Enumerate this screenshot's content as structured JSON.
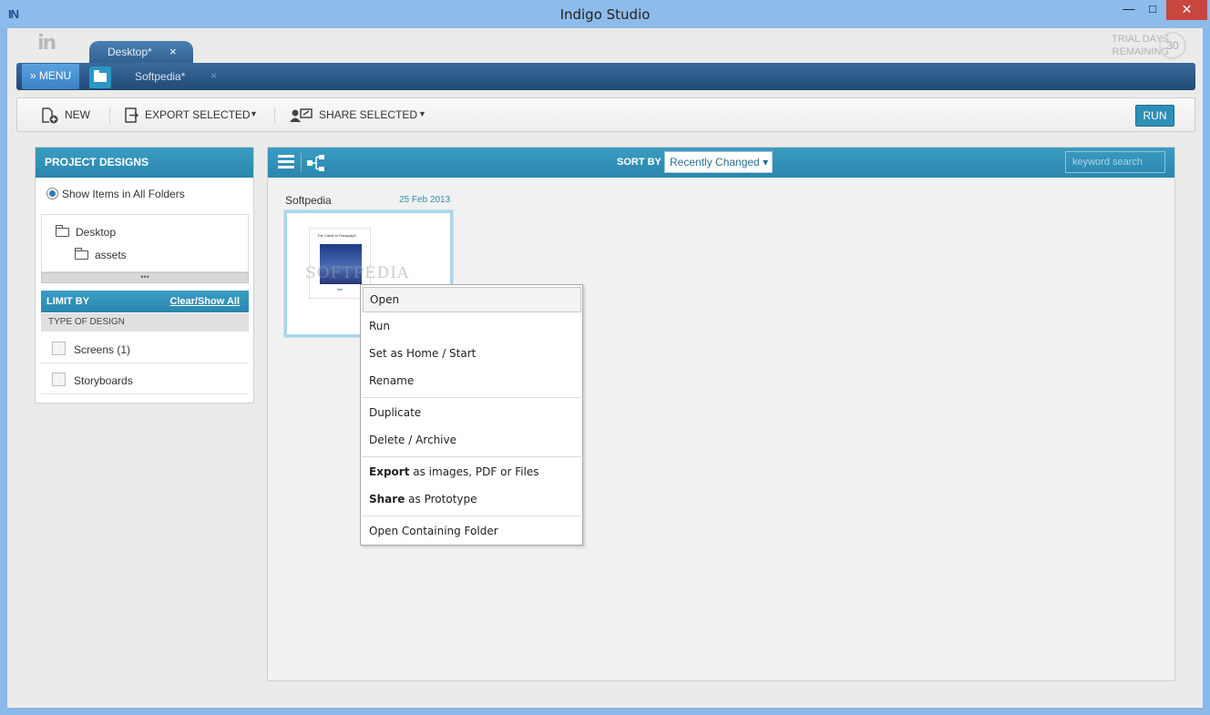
{
  "window": {
    "title": "Indigo Studio",
    "app_icon": "IN",
    "minimize": "—",
    "maximize": "□",
    "close": "✕"
  },
  "logo": {
    "text": "in"
  },
  "trial": {
    "line1": "TRIAL DAYS",
    "line2": "REMAINING",
    "days": "30"
  },
  "tabs": {
    "document_tab": "Desktop*",
    "document_close": "×",
    "menu_label": "» MENU",
    "sub_tab": "Softpedia*",
    "sub_tab_close": "×"
  },
  "toolbar": {
    "new_label": "NEW",
    "export_label": "EXPORT SELECTED",
    "share_label": "SHARE SELECTED",
    "run_label": "RUN",
    "dropdown_caret": "▼"
  },
  "left_panel": {
    "header": "PROJECT DESIGNS",
    "radio_label": "Show Items in All Folders",
    "tree": [
      "Desktop",
      "assets"
    ],
    "scroll_handle": "•••",
    "limit_by": "LIMIT BY",
    "clear_show_all": "Clear/Show All",
    "type_header": "TYPE OF DESIGN",
    "filters": [
      "Screens (1)",
      "Storyboards"
    ]
  },
  "main_panel": {
    "sort_by": "SORT BY",
    "sort_value": "Recently Changed ▾",
    "search_placeholder": "keyword search",
    "card": {
      "name": "Softpedia",
      "date": "25 Feb 2013",
      "thumb_title": "The Cabal to Paragraph",
      "thumb_footer": "link",
      "watermark": "SOFTPEDIA"
    }
  },
  "context_menu": {
    "items": [
      {
        "label": "Open"
      },
      {
        "label": "Run"
      },
      {
        "label": "Set as Home / Start"
      },
      {
        "label": "Rename"
      },
      {
        "label": "Duplicate"
      },
      {
        "label": "Delete / Archive"
      },
      {
        "bold": "Export",
        "rest": " as images, PDF or Files"
      },
      {
        "bold": "Share",
        "rest": " as Prototype"
      },
      {
        "label": "Open Containing Folder"
      }
    ]
  },
  "colors": {
    "accent": "#2e8fb6",
    "nav_blue": "#1f4a77",
    "titlebar": "#8dbbec",
    "close_red": "#c7463e"
  }
}
